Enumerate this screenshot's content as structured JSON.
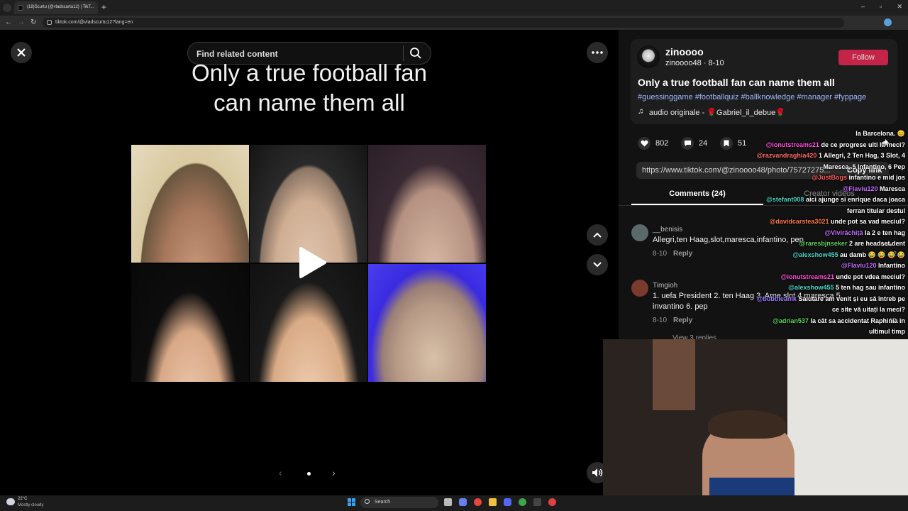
{
  "browser": {
    "tab_title": "(18)Scurtu (@vladscurtu12) | TikT...",
    "url": "tiktok.com/@vladscurtu12?lang=en"
  },
  "viewer": {
    "search_placeholder": "Find related content",
    "headline_line1": "Only a true football fan",
    "headline_line2": "can name them all",
    "photo_tiles": 6
  },
  "post": {
    "author_name": "zinoooo",
    "author_handle": "zinoooo48 · 8-10",
    "follow_label": "Follow",
    "title": "Only a true football fan can name them all",
    "hashtags": "#guessinggame #footballquiz #ballknowledge #manager #fyppage",
    "audio": "audio originale - 🌹Gabriel_il_debue🌹",
    "likes": "802",
    "comments": "24",
    "saves": "51",
    "link": "https://www.tiktok.com/@zinoooo48/photo/75727275...",
    "copy_link": "Copy link",
    "tab_comments": "Comments (24)",
    "tab_creator": "Creator videos"
  },
  "comments": [
    {
      "user": "__benisis",
      "text": "Allegri,ten Haag,slot,maresca,infantino, pep",
      "date": "8-10",
      "reply": "Reply",
      "likes": "62"
    },
    {
      "user": "Timgioh",
      "text_line1": "1. uefa President 2. ten Haag 3. Arne slot 4.maresca 5.",
      "text_line2": "invantino 6. pep",
      "date": "8-10",
      "reply": "Reply",
      "likes": "12"
    }
  ],
  "view_replies": "View 3 replies",
  "chat": [
    {
      "user": "",
      "msg": "la Barcelona. 😊",
      "color": "#ffffff"
    },
    {
      "user": "@ionutstreams21",
      "msg": "de ce progrese ulti la meci?",
      "color": "#ff4fd8"
    },
    {
      "user": "@razvandraghia420",
      "msg": "1 Allegri, 2 Ten Hag, 3 Slot, 4",
      "color": "#ff6b6b"
    },
    {
      "user": "",
      "msg": "Maresca, 5 Infantino, 6 Pep",
      "color": "#ffffff"
    },
    {
      "user": "@JustBogs",
      "msg": "infantino e mid jos",
      "color": "#ff5a5a"
    },
    {
      "user": "@Flaviu120",
      "msg": "Maresca",
      "color": "#c46bff"
    },
    {
      "user": "@stefant008",
      "msg": "aici ajunge si enrique daca joaca",
      "color": "#4fd6c8"
    },
    {
      "user": "",
      "msg": "ferran titular destul",
      "color": "#ffffff"
    },
    {
      "user": "@davidcarstea3021",
      "msg": "unde pot sa vad meciul?",
      "color": "#ff7a4f"
    },
    {
      "user": "@Vivirăchiță",
      "msg": "la 2 e ten hag",
      "color": "#c46bff"
    },
    {
      "user": "@raresbjnseker",
      "msg": "2 are headset dent",
      "color": "#5fd35f"
    },
    {
      "user": "@alexshow455",
      "msg": "au damb 😂 😂 😂 😂",
      "color": "#4fd6c8"
    },
    {
      "user": "@Flaviu120",
      "msg": "Infantino",
      "color": "#c46bff"
    },
    {
      "user": "@ionutstreams21",
      "msg": "unde pot vdea meciul?",
      "color": "#ff4fd8"
    },
    {
      "user": "@alexshow455",
      "msg": "5 ten hag sau infantino",
      "color": "#4fd6c8"
    },
    {
      "user": "@bubbleanik",
      "msg": "Salutare am venit și eu să întreb pe",
      "color": "#9b7bff"
    },
    {
      "user": "",
      "msg": "ce site vă uitați la meci?",
      "color": "#ffffff"
    },
    {
      "user": "@adrian537",
      "msg": "la cât sa accidentat Raphinia în",
      "color": "#5fd35f"
    },
    {
      "user": "",
      "msg": "ultimul timp",
      "color": "#ffffff"
    }
  ],
  "taskbar": {
    "weather_temp": "22°C",
    "weather_desc": "Mostly cloudy",
    "search_label": "Search"
  },
  "icons": [
    "close-icon",
    "search-icon",
    "more-icon",
    "play-icon",
    "chevron-up-icon",
    "chevron-down-icon",
    "volume-icon",
    "heart-icon",
    "comment-icon",
    "bookmark-icon",
    "share-icon",
    "music-note-icon"
  ]
}
